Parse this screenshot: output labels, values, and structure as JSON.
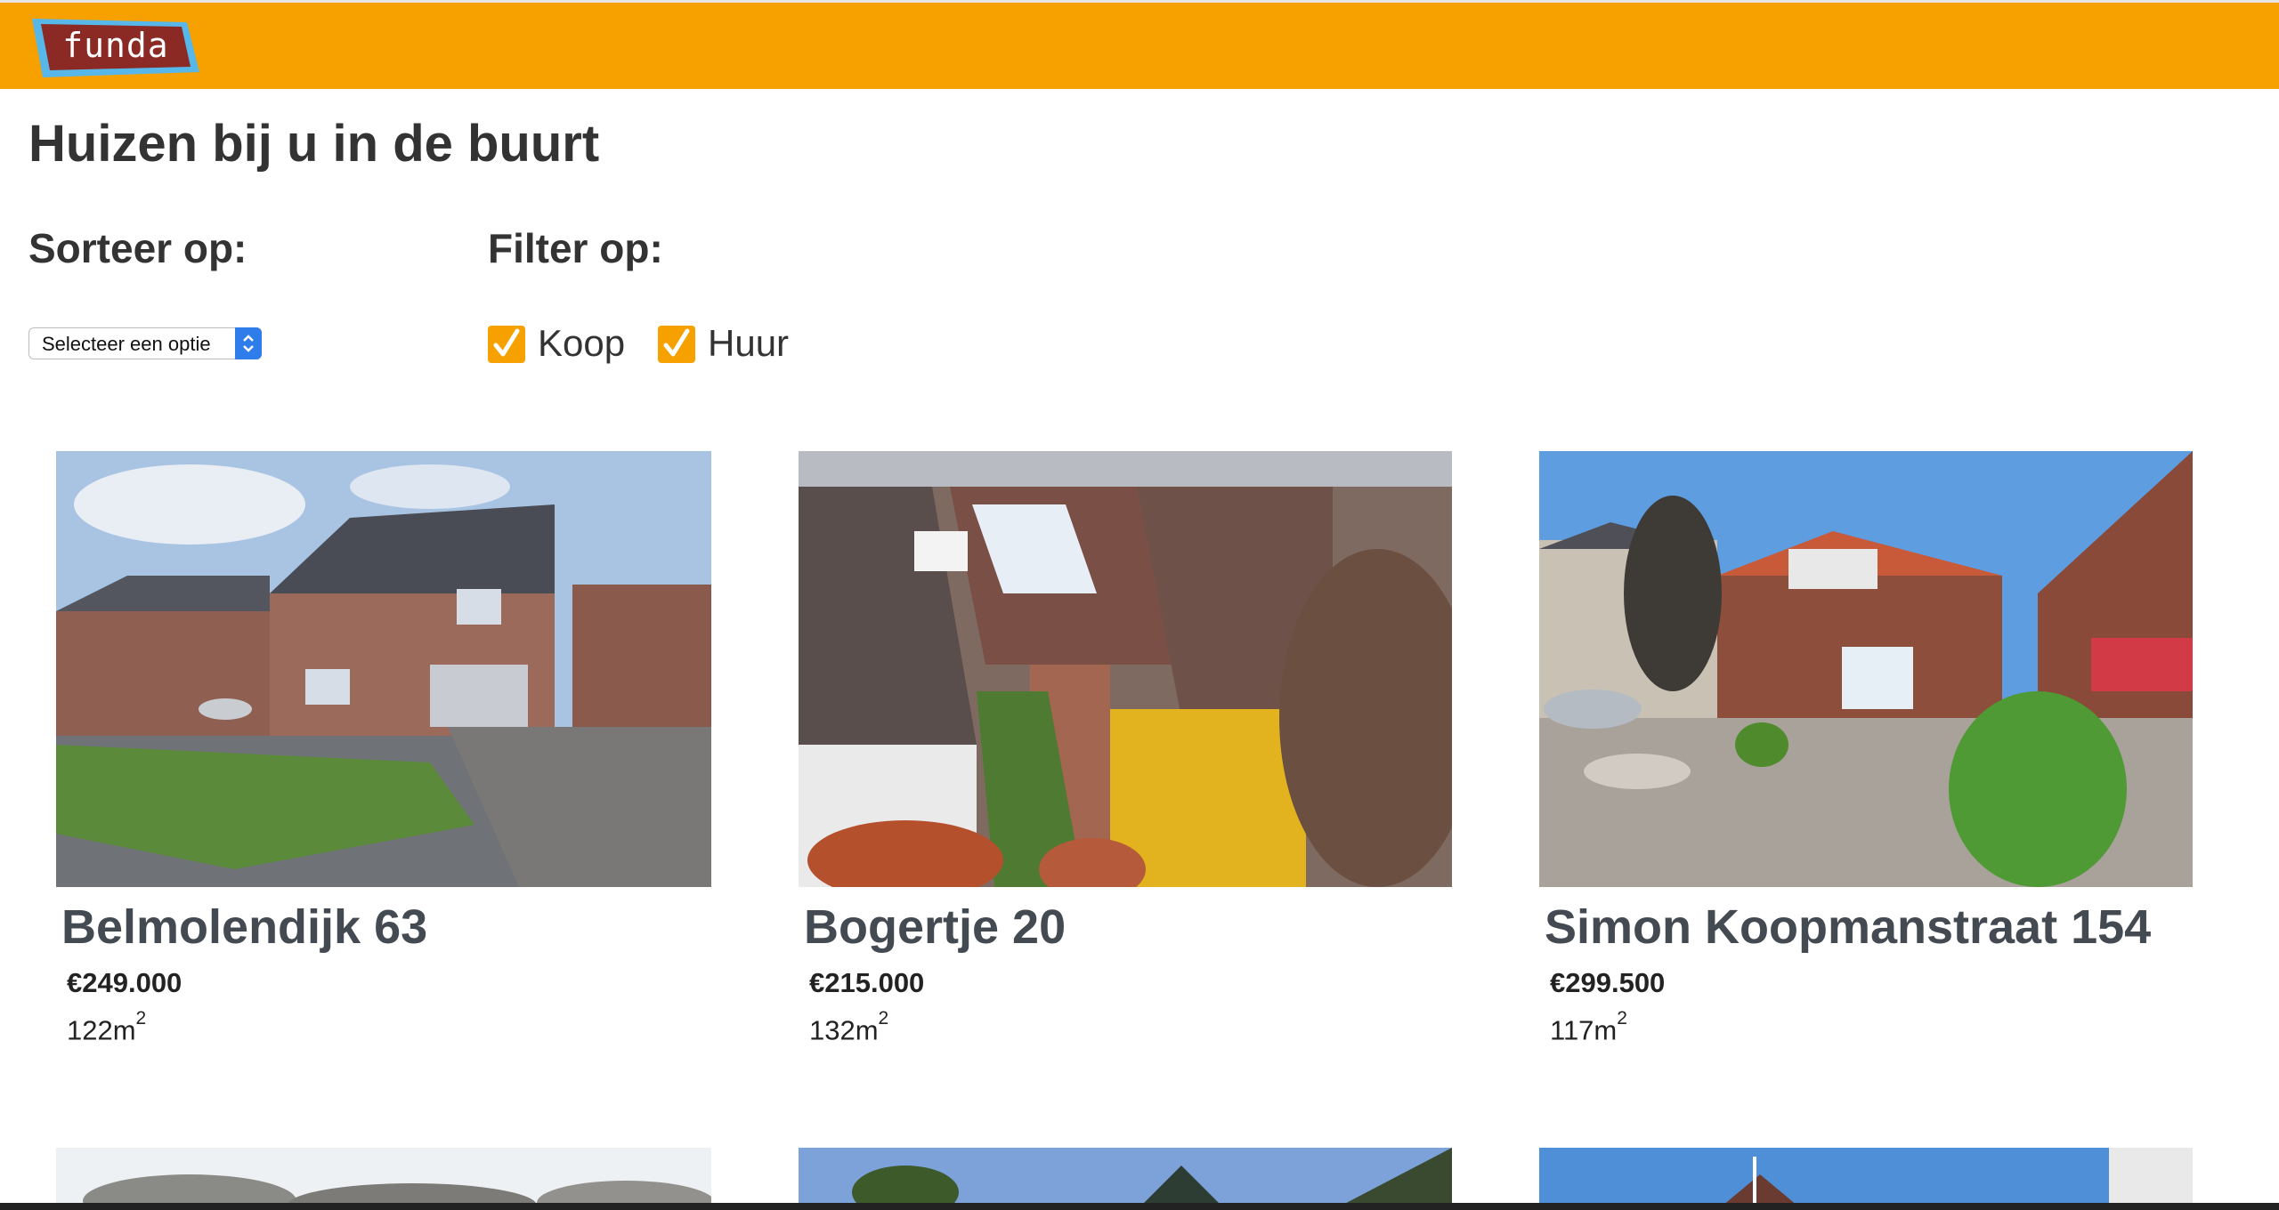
{
  "header": {
    "logo_text": "funda",
    "brand_color": "#f7a100"
  },
  "page": {
    "title": "Huizen bij u in de buurt"
  },
  "sort": {
    "label": "Sorteer op:",
    "selected": "Selecteer een optie"
  },
  "filter": {
    "label": "Filter op:",
    "options": [
      {
        "label": "Koop",
        "checked": true
      },
      {
        "label": "Huur",
        "checked": true
      }
    ]
  },
  "listings": [
    {
      "address": "Belmolendijk 63",
      "price": "€249.000",
      "area": "122m",
      "area_unit_exp": "2"
    },
    {
      "address": "Bogertje 20",
      "price": "€215.000",
      "area": "132m",
      "area_unit_exp": "2"
    },
    {
      "address": "Simon Koopmanstraat 154",
      "price": "€299.500",
      "area": "117m",
      "area_unit_exp": "2"
    }
  ]
}
